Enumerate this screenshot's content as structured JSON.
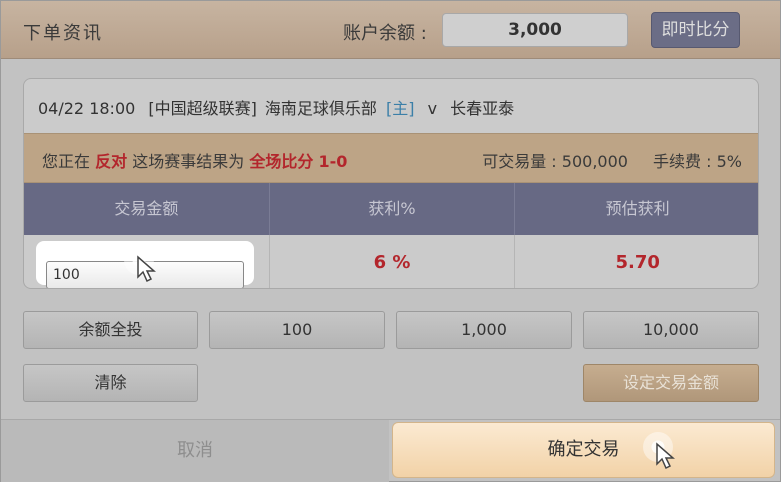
{
  "header": {
    "title": "下单资讯",
    "balance_label": "账户余额 :",
    "balance_value": "3,000",
    "live_score_button": "即时比分"
  },
  "match": {
    "datetime": "04/22 18:00",
    "league": "[中国超级联赛]",
    "home_team": "海南足球俱乐部",
    "home_tag": "[主]",
    "vs": "v",
    "away_team": "长春亚泰"
  },
  "info": {
    "prefix": "您正在",
    "action": "反对",
    "middle": "这场赛事结果为",
    "market": "全场比分",
    "score": "1-0",
    "available": "可交易量 : 500,000",
    "fee": "手续费 : 5%"
  },
  "table": {
    "headers": [
      "交易金额",
      "获利%",
      "预估获利"
    ],
    "amount_value": "100",
    "profit_percent": "6 %",
    "estimated_profit": "5.70"
  },
  "quick_amounts": {
    "all_in": "余额全投",
    "amount_100": "100",
    "amount_1000": "1,000",
    "amount_10000": "10,000"
  },
  "actions": {
    "clear": "清除",
    "set_amount": "设定交易金额",
    "cancel": "取消",
    "confirm": "确定交易"
  }
}
